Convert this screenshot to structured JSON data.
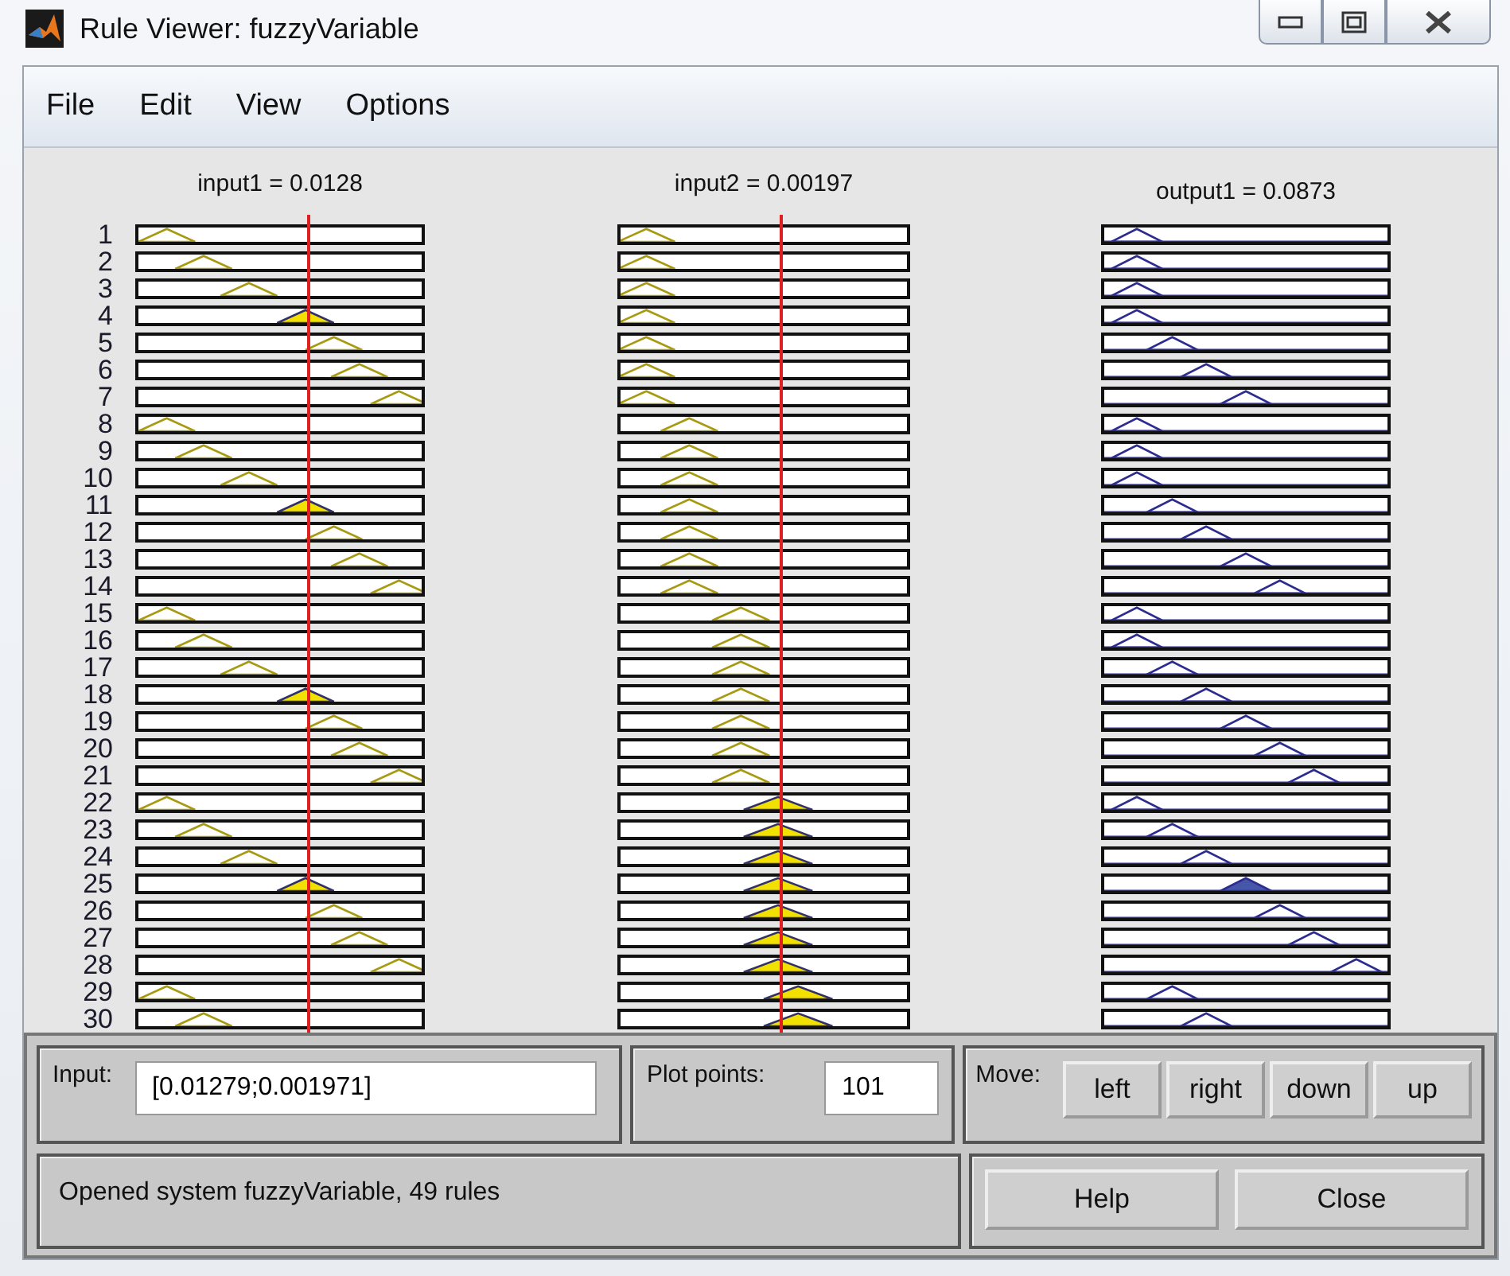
{
  "window": {
    "title": "Rule Viewer: fuzzyVariable"
  },
  "menu": [
    "File",
    "Edit",
    "View",
    "Options"
  ],
  "variables": [
    {
      "label": "input1 = 0.0128"
    },
    {
      "label": "input2 = 0.00197"
    },
    {
      "label": "output1 = 0.0873"
    }
  ],
  "rules": [
    {
      "number": "1",
      "filled": [
        false,
        false,
        false
      ]
    },
    {
      "number": "2",
      "filled": [
        false,
        false,
        false
      ]
    },
    {
      "number": "3",
      "filled": [
        false,
        false,
        false
      ]
    },
    {
      "number": "4",
      "filled": [
        true,
        false,
        false
      ]
    },
    {
      "number": "5",
      "filled": [
        false,
        false,
        false
      ]
    },
    {
      "number": "6",
      "filled": [
        false,
        false,
        false
      ]
    },
    {
      "number": "7",
      "filled": [
        false,
        false,
        false
      ]
    },
    {
      "number": "8",
      "filled": [
        false,
        false,
        false
      ]
    },
    {
      "number": "9",
      "filled": [
        false,
        false,
        false
      ]
    },
    {
      "number": "10",
      "filled": [
        false,
        false,
        false
      ]
    },
    {
      "number": "11",
      "filled": [
        true,
        false,
        false
      ]
    },
    {
      "number": "12",
      "filled": [
        false,
        false,
        false
      ]
    },
    {
      "number": "13",
      "filled": [
        false,
        false,
        false
      ]
    },
    {
      "number": "14",
      "filled": [
        false,
        false,
        false
      ]
    },
    {
      "number": "15",
      "filled": [
        false,
        false,
        false
      ]
    },
    {
      "number": "16",
      "filled": [
        false,
        false,
        false
      ]
    },
    {
      "number": "17",
      "filled": [
        false,
        false,
        false
      ]
    },
    {
      "number": "18",
      "filled": [
        true,
        false,
        false
      ]
    },
    {
      "number": "19",
      "filled": [
        false,
        false,
        false
      ]
    },
    {
      "number": "20",
      "filled": [
        false,
        false,
        false
      ]
    },
    {
      "number": "21",
      "filled": [
        false,
        false,
        false
      ]
    },
    {
      "number": "22",
      "filled": [
        false,
        true,
        false
      ]
    },
    {
      "number": "23",
      "filled": [
        false,
        true,
        false
      ]
    },
    {
      "number": "24",
      "filled": [
        false,
        true,
        false
      ]
    },
    {
      "number": "25",
      "filled": [
        true,
        true,
        true
      ]
    },
    {
      "number": "26",
      "filled": [
        false,
        true,
        false
      ]
    },
    {
      "number": "27",
      "filled": [
        false,
        true,
        false
      ]
    },
    {
      "number": "28",
      "filled": [
        false,
        true,
        false
      ]
    },
    {
      "number": "29",
      "filled": [
        false,
        true,
        false
      ]
    },
    {
      "number": "30",
      "filled": [
        false,
        true,
        false
      ]
    }
  ],
  "input": {
    "label": "Input:",
    "value": "[0.01279;0.001971]"
  },
  "plot_points": {
    "label": "Plot points:",
    "value": "101"
  },
  "move": {
    "label": "Move:",
    "buttons": [
      "left",
      "right",
      "down",
      "up"
    ]
  },
  "status": "Opened system fuzzyVariable, 49 rules",
  "buttons": [
    "Help",
    "Close"
  ]
}
